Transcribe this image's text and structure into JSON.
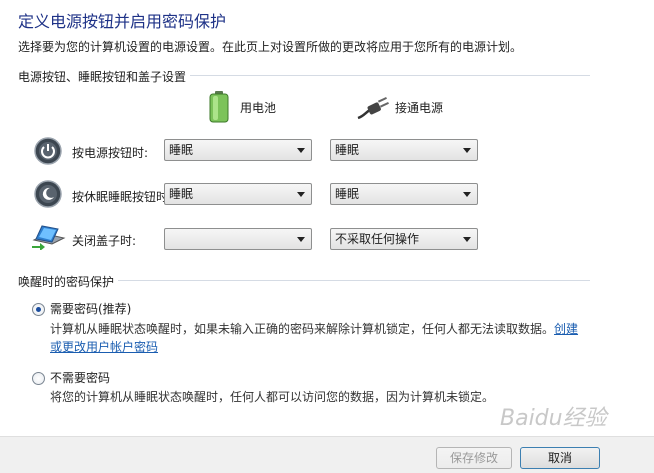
{
  "page": {
    "title": "定义电源按钮并启用密码保护",
    "intro": "选择要为您的计算机设置的电源设置。在此页上对设置所做的更改将应用于您所有的电源计划。"
  },
  "buttons_section": {
    "heading": "电源按钮、睡眠按钮和盖子设置",
    "columns": {
      "battery": "用电池",
      "plugged": "接通电源"
    },
    "rows": [
      {
        "label": "按电源按钮时:",
        "battery": "睡眠",
        "plugged": "睡眠",
        "icon": "power-button-icon"
      },
      {
        "label": "按休眠睡眠按钮时:",
        "battery": "睡眠",
        "plugged": "睡眠",
        "icon": "sleep-button-icon"
      },
      {
        "label": "关闭盖子时:",
        "battery": "",
        "plugged": "不采取任何操作",
        "icon": "laptop-lid-icon"
      }
    ]
  },
  "password_section": {
    "heading": "唤醒时的密码保护",
    "require": {
      "label": "需要密码(推荐)",
      "desc": "计算机从睡眠状态唤醒时，如果未输入正确的密码来解除计算机锁定，任何人都无法读取数据。",
      "link": "创建或更改用户帐户密码",
      "selected": true
    },
    "no_require": {
      "label": "不需要密码",
      "desc": "将您的计算机从睡眠状态唤醒时，任何人都可以访问您的数据，因为计算机未锁定。",
      "selected": false
    }
  },
  "footer": {
    "save": "保存修改",
    "cancel": "取消"
  },
  "watermark": "Baidu经验"
}
